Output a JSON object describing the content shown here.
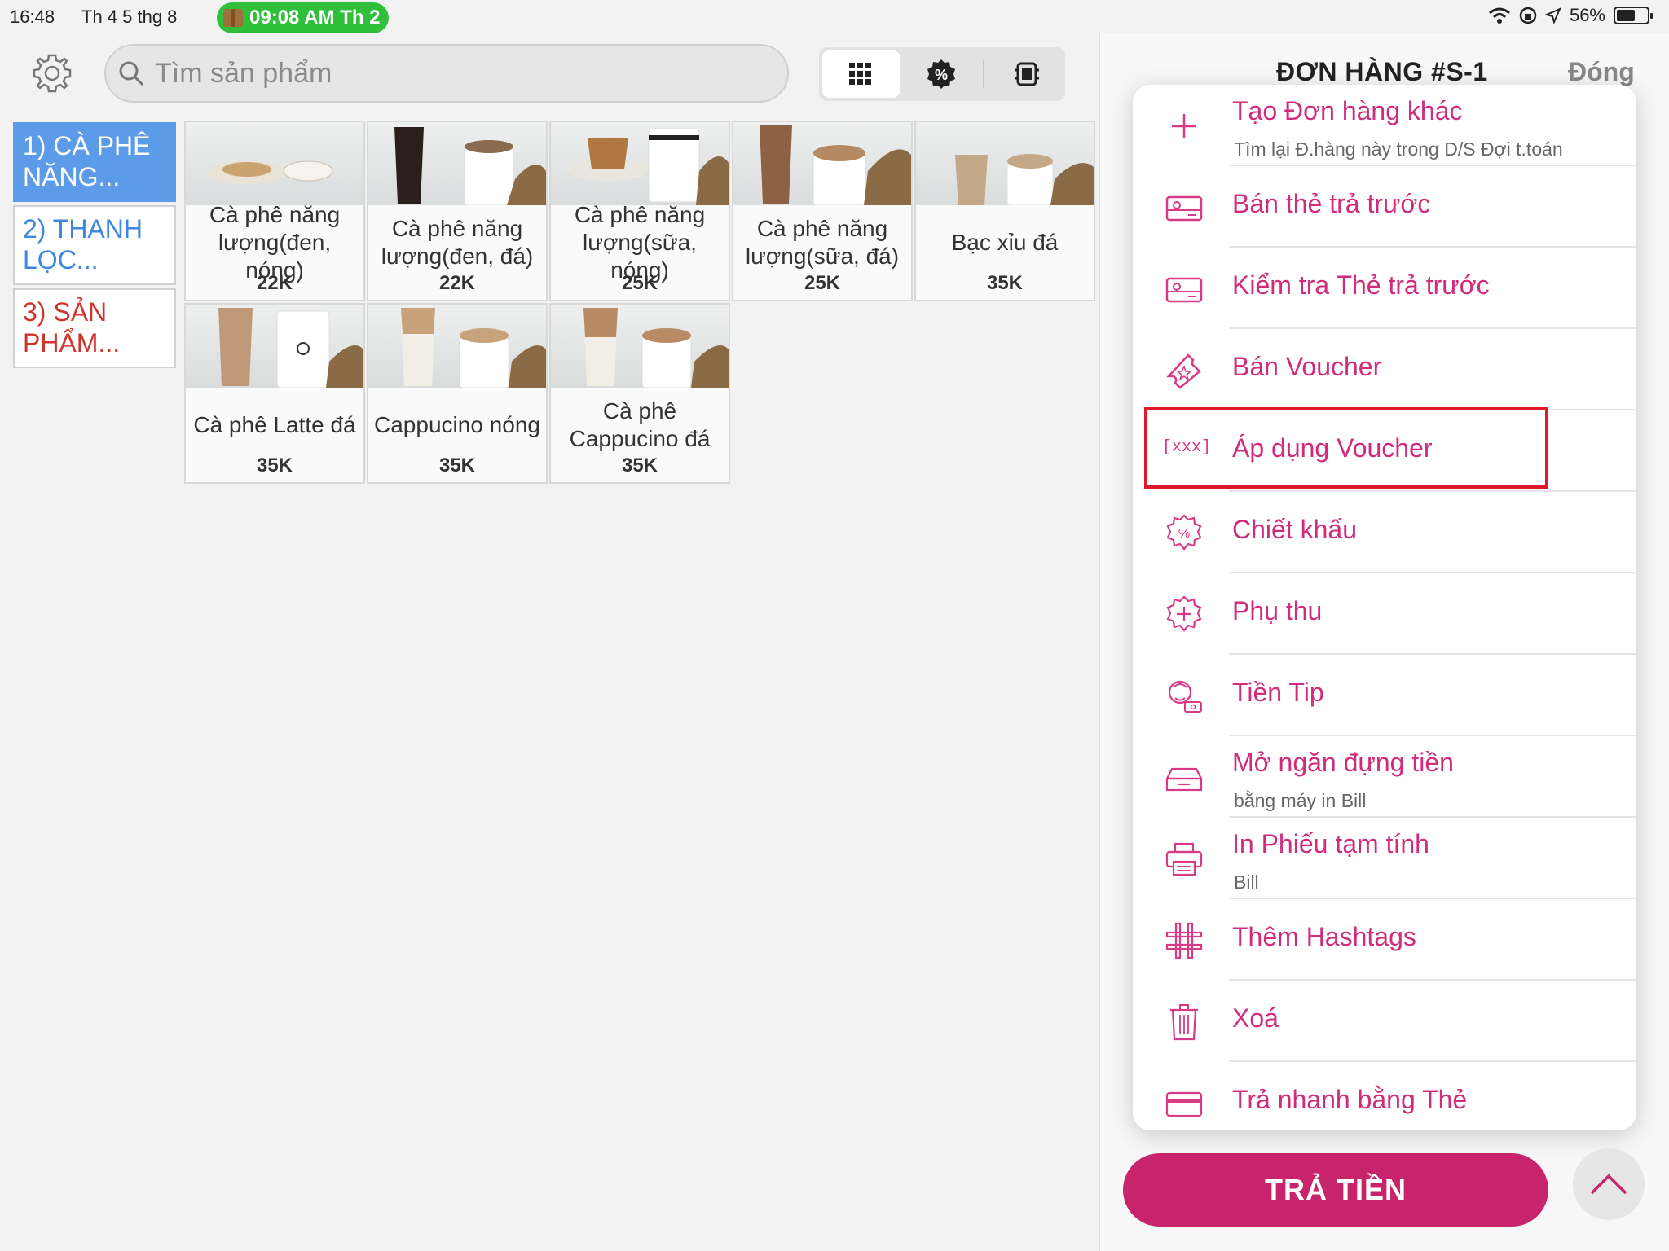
{
  "status_bar": {
    "time": "16:48",
    "date": "Th 4 5 thg 8",
    "pill_text": "09:08 AM Th 2",
    "battery": "56%"
  },
  "search": {
    "placeholder": "Tìm sản phẩm"
  },
  "categories": [
    {
      "label": "1) CÀ PHÊ NĂNG..."
    },
    {
      "label": "2) THANH LỌC..."
    },
    {
      "label": "3) SẢN PHẨM..."
    }
  ],
  "products": [
    {
      "name": "Cà phê năng lượng(đen, nóng)",
      "price": "22K"
    },
    {
      "name": "Cà phê năng lượng(đen, đá)",
      "price": "22K"
    },
    {
      "name": "Cà phê năng lượng(sữa, nóng)",
      "price": "25K"
    },
    {
      "name": "Cà phê năng lượng(sữa, đá)",
      "price": "25K"
    },
    {
      "name": "Bạc xỉu đá",
      "price": "35K"
    },
    {
      "name": "Cà phê Latte đá",
      "price": "35K"
    },
    {
      "name": "Cappucino nóng",
      "price": "35K"
    },
    {
      "name": "Cà phê Cappucino đá",
      "price": "35K"
    }
  ],
  "order": {
    "title": "ĐƠN HÀNG #S-1",
    "close_label": "Đóng"
  },
  "menu": {
    "items": [
      {
        "label": "Tạo Đơn hàng khác",
        "sub": "Tìm lại Đ.hàng này trong D/S Đợi t.toán",
        "icon": "plus-icon"
      },
      {
        "label": "Bán thẻ trả trước",
        "sub": "",
        "icon": "gift-card-icon"
      },
      {
        "label": "Kiểm tra Thẻ trả trước",
        "sub": "",
        "icon": "gift-card-check-icon"
      },
      {
        "label": "Bán Voucher",
        "sub": "",
        "icon": "ticket-icon"
      },
      {
        "label": "Áp dụng Voucher",
        "sub": "",
        "icon": "voucher-code-icon",
        "icon_text": "[xxx]"
      },
      {
        "label": "Chiết khấu",
        "sub": "",
        "icon": "discount-badge-icon"
      },
      {
        "label": "Phụ thu",
        "sub": "",
        "icon": "surcharge-badge-icon"
      },
      {
        "label": "Tiền Tip",
        "sub": "",
        "icon": "tip-icon"
      },
      {
        "label": "Mở ngăn đựng tiền",
        "sub": "bằng máy in Bill",
        "icon": "cash-drawer-icon"
      },
      {
        "label": "In Phiếu tạm tính",
        "sub": "Bill",
        "icon": "printer-icon"
      },
      {
        "label": "Thêm Hashtags",
        "sub": "",
        "icon": "hashtag-icon"
      },
      {
        "label": "Xoá",
        "sub": "",
        "icon": "trash-icon"
      },
      {
        "label": "Trả nhanh bằng Thẻ",
        "sub": "",
        "icon": "credit-card-icon"
      }
    ]
  },
  "pay_button": {
    "label": "TRẢ TIỀN"
  },
  "colors": {
    "accent": "#d12c7c",
    "pay_button": "#c8246c",
    "category_active": "#5b9be8",
    "status_pill": "#2fbf3a",
    "highlight": "#e0182b"
  }
}
